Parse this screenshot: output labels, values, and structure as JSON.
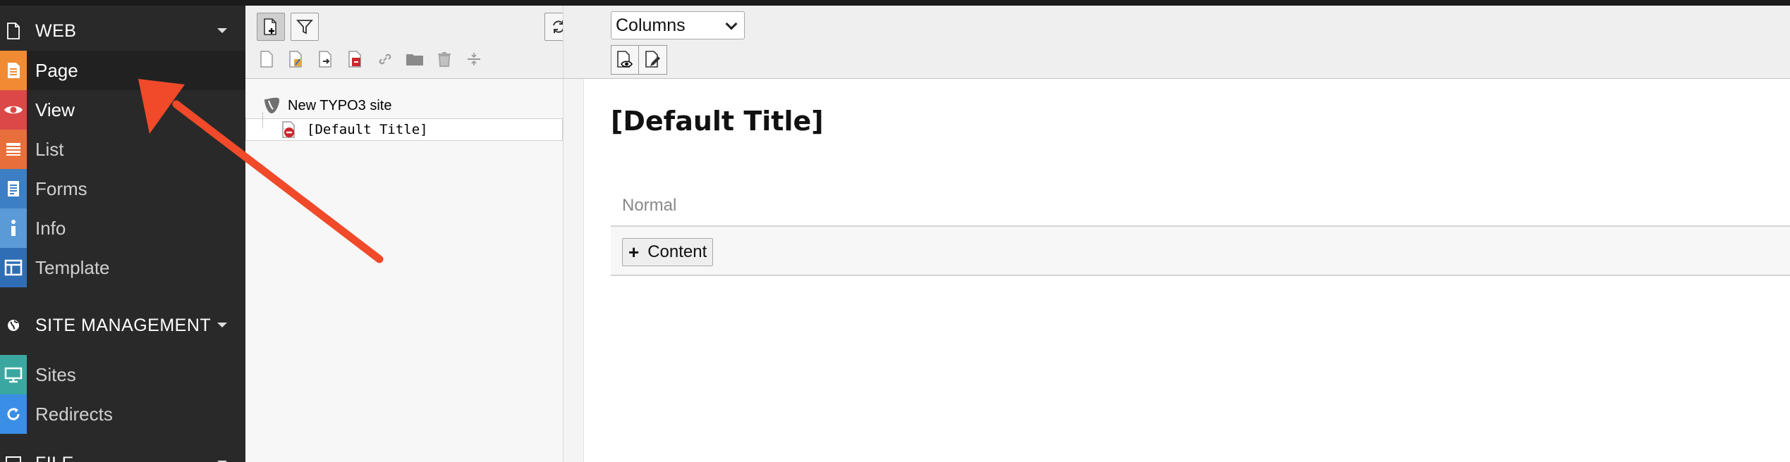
{
  "module_menu": {
    "groups": [
      {
        "label": "WEB",
        "icon": "page-icon"
      },
      {
        "label": "SITE MANAGEMENT",
        "icon": "globe-icon"
      },
      {
        "label": "FILE",
        "icon": "image-icon"
      }
    ],
    "web_items": [
      {
        "label": "Page",
        "icon": "page-module-icon",
        "color": "#f08b34"
      },
      {
        "label": "View",
        "icon": "eye-icon",
        "color": "#dc4848"
      },
      {
        "label": "List",
        "icon": "list-icon",
        "color": "#e86f3b"
      },
      {
        "label": "Forms",
        "icon": "forms-icon",
        "color": "#3c7fc4"
      },
      {
        "label": "Info",
        "icon": "info-icon",
        "color": "#5a9ad6"
      },
      {
        "label": "Template",
        "icon": "template-icon",
        "color": "#2f6eb5"
      }
    ],
    "site_items": [
      {
        "label": "Sites",
        "icon": "sites-icon",
        "color": "#3aa8a0"
      },
      {
        "label": "Redirects",
        "icon": "redirect-icon",
        "color": "#3a8ee6"
      }
    ]
  },
  "tree": {
    "root_label": "New TYPO3 site",
    "child_label": "[Default Title]",
    "toolbar_icons": [
      "new-page-icon",
      "new-page-edit-icon",
      "page-move-icon",
      "page-delete-red-icon",
      "link-icon",
      "folder-icon",
      "trash-icon",
      "divider-icon"
    ]
  },
  "content": {
    "view_select": "Columns",
    "page_title": "[Default Title]",
    "column_name": "Normal",
    "add_content_label": "Content"
  },
  "colors": {
    "annotation_arrow": "#f04a2a",
    "menu_bg": "#292929"
  }
}
